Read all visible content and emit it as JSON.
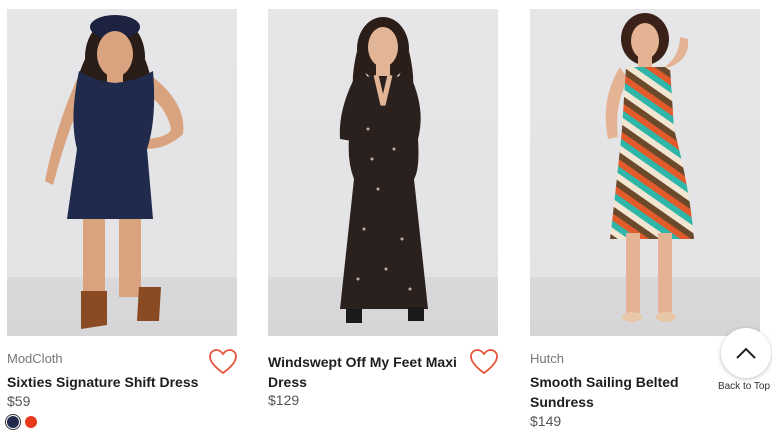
{
  "products": [
    {
      "brand": "ModCloth",
      "name": "Sixties Signature Shift Dress",
      "price": "$59",
      "swatches": [
        {
          "color": "#1f2a4d",
          "selected": true
        },
        {
          "color": "#e8391c",
          "selected": false
        }
      ],
      "image_icon": "navy-shift-dress-photo"
    },
    {
      "brand": "",
      "name": "Windswept Off My Feet Maxi Dress",
      "price": "$129",
      "image_icon": "floral-maxi-dress-photo"
    },
    {
      "brand": "Hutch",
      "name": "Smooth Sailing Belted Sundress",
      "price": "$149",
      "image_icon": "striped-sundress-photo"
    }
  ],
  "back_to_top": {
    "label": "Back to Top",
    "icon": "chevron-up-icon"
  },
  "colors": {
    "heart": "#e8553a",
    "accent": "#333333"
  }
}
